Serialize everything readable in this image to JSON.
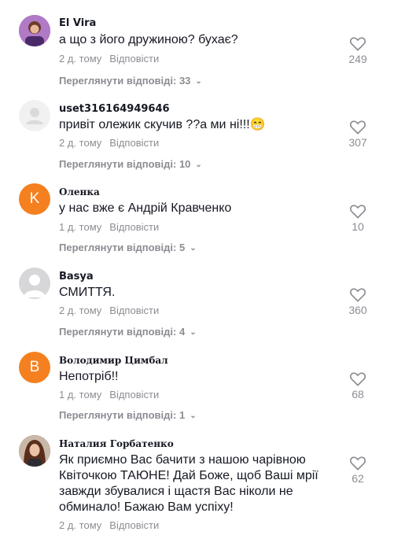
{
  "comments": [
    {
      "author": "El Vira",
      "avatar": {
        "kind": "photo",
        "bg": "#8e5aa8"
      },
      "text": "а що з його дружиною? бухає?",
      "age": "2 д. тому",
      "reply_label": "Відповісти",
      "likes": "249",
      "view_replies": "Переглянути відповіді: 33"
    },
    {
      "author": "uset316164949646",
      "avatar": {
        "kind": "default",
        "bg": "#f1f1f2"
      },
      "text": "привіт олежик скучив ??а ми ні!!!😁",
      "age": "2 д. тому",
      "reply_label": "Відповісти",
      "likes": "307",
      "view_replies": "Переглянути відповіді: 10"
    },
    {
      "author": "Оленка",
      "avatar": {
        "kind": "letter",
        "letter": "K",
        "bg": "#f5801f"
      },
      "text": "у нас вже є Андрій Кравченко",
      "age": "1 д. тому",
      "reply_label": "Відповісти",
      "likes": "10",
      "view_replies": "Переглянути відповіді: 5"
    },
    {
      "author": "Basya",
      "avatar": {
        "kind": "grey",
        "bg": "#d7d7d9"
      },
      "text": "СМИТТЯ.",
      "age": "2 д. тому",
      "reply_label": "Відповісти",
      "likes": "360",
      "view_replies": "Переглянути відповіді: 4"
    },
    {
      "author": "Володимир Цимбал",
      "avatar": {
        "kind": "letter",
        "letter": "B",
        "bg": "#f5801f"
      },
      "text": "Непотріб!!",
      "age": "1 д. тому",
      "reply_label": "Відповісти",
      "likes": "68",
      "view_replies": "Переглянути відповіді: 1"
    },
    {
      "author": "Наталия Горбатенко",
      "avatar": {
        "kind": "photo",
        "bg": "#7a4a3a"
      },
      "text": "Як приємно Вас бачити з нашою чарівною Квіточкою ТАЮНЕ! Дай Боже, щоб Ваші мрії завжди збувалися і щастя Вас ніколи не обминало! Бажаю Вам успіху!",
      "age": "2 д. тому",
      "reply_label": "Відповісти",
      "likes": "62"
    }
  ]
}
